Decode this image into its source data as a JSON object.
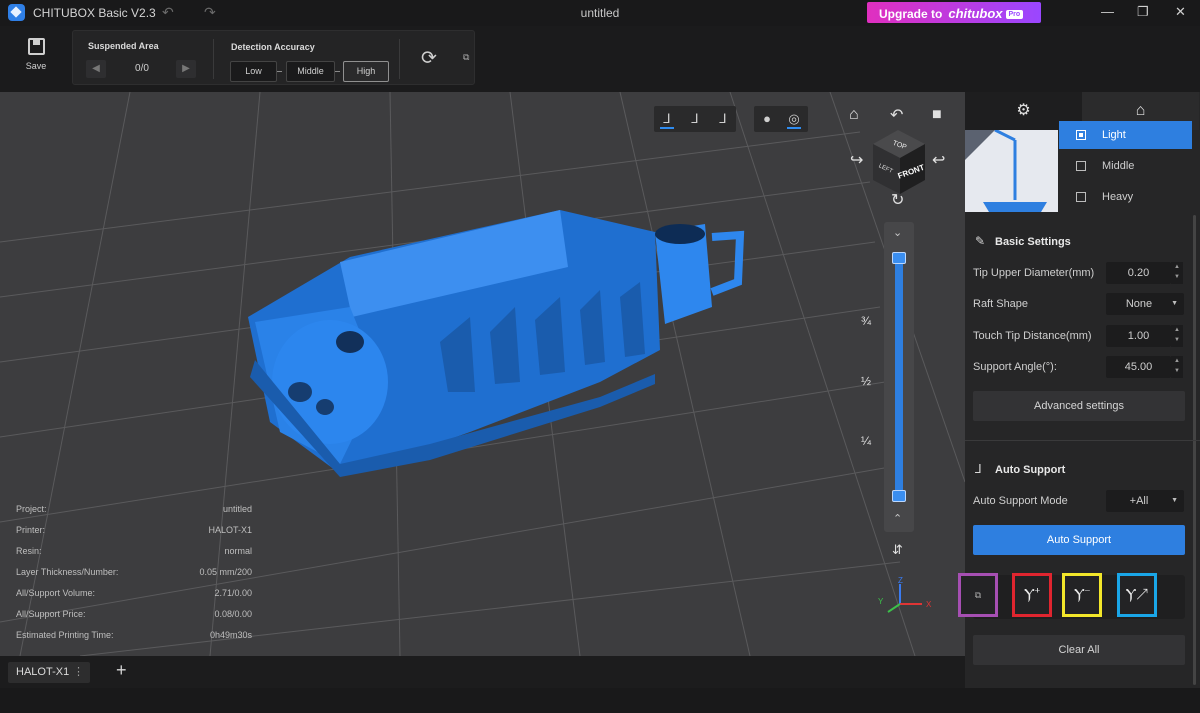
{
  "window": {
    "app_title": "CHITUBOX Basic V2.3",
    "doc_title": "untitled",
    "upgrade_label": "Upgrade to",
    "upgrade_brand": "chitubox",
    "upgrade_badge": "Pro",
    "accent": "#2e7fe0"
  },
  "toolbar": {
    "save_label": "Save",
    "suspended_area": {
      "title": "Suspended Area",
      "count": "0/0"
    },
    "detection_accuracy": {
      "title": "Detection Accuracy",
      "options": [
        "Low",
        "Middle",
        "High"
      ],
      "selected": "High"
    }
  },
  "viewport": {
    "cube_faces": {
      "top": "TOP",
      "front": "FRONT",
      "left": "LEFT"
    },
    "slider_marks": [
      "¾",
      "½",
      "¼"
    ],
    "axes": {
      "x": "X",
      "y": "Y",
      "z": "Z"
    },
    "info": [
      {
        "key": "Project:",
        "value": "untitled"
      },
      {
        "key": "Printer:",
        "value": "HALOT-X1"
      },
      {
        "key": "Resin:",
        "value": "normal"
      },
      {
        "key": "Layer Thickness/Number:",
        "value": "0.05 mm/200"
      },
      {
        "key": "All/Support Volume:",
        "value": "2.71/0.00"
      },
      {
        "key": "All/Support Price:",
        "value": "0.08/0.00"
      },
      {
        "key": "Estimated Printing Time:",
        "value": "0h49m30s"
      }
    ]
  },
  "right_panel": {
    "presets": [
      "Light",
      "Middle",
      "Heavy"
    ],
    "selected_preset": "Light",
    "basic_settings": {
      "title": "Basic Settings",
      "tip_upper_diameter": {
        "label": "Tip Upper Diameter(mm)",
        "value": "0.20"
      },
      "raft_shape": {
        "label": "Raft Shape",
        "value": "None"
      },
      "touch_tip_distance": {
        "label": "Touch Tip Distance(mm)",
        "value": "1.00"
      },
      "support_angle": {
        "label": "Support Angle(°):",
        "value": "45.00"
      },
      "advanced_label": "Advanced settings"
    },
    "auto_support": {
      "title": "Auto Support",
      "mode_label": "Auto Support Mode",
      "mode_value": "+All",
      "button_label": "Auto Support"
    },
    "clear_all_label": "Clear All"
  },
  "bottom": {
    "printer_tab": "HALOT-X1",
    "add_tab": "+"
  }
}
